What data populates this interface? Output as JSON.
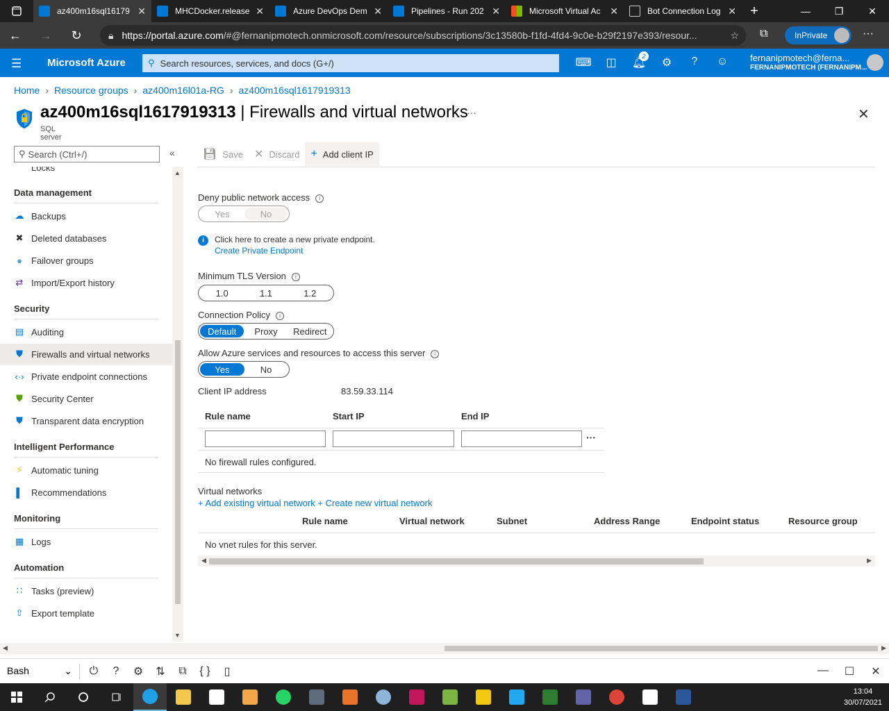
{
  "browser": {
    "tabs": [
      {
        "title": "az400m16sql16179",
        "icon": "azure-icon",
        "active": true
      },
      {
        "title": "MHCDocker.release",
        "icon": "devops-icon",
        "active": false
      },
      {
        "title": "Azure DevOps Dem",
        "icon": "devops-icon",
        "active": false
      },
      {
        "title": "Pipelines - Run 202",
        "icon": "devops-icon",
        "active": false
      },
      {
        "title": "Microsoft Virtual Ac",
        "icon": "microsoft-icon",
        "active": false
      },
      {
        "title": "Bot Connection Log",
        "icon": "document-icon",
        "active": false
      }
    ],
    "url_host": "https://portal.azure.com",
    "url_rest": "/#@fernanipmotech.onmicrosoft.com/resource/subscriptions/3c13580b-f1fd-4fd4-9c0e-b29f2197e393/resour...",
    "inprivate_label": "InPrivate"
  },
  "azure_header": {
    "brand": "Microsoft Azure",
    "search_placeholder": "Search resources, services, and docs (G+/)",
    "notifications_count": "2",
    "account_name": "fernanipmotech@ferna...",
    "account_tenant": "FERNANIPMOTECH (FERNANIPM..."
  },
  "breadcrumb": [
    "Home",
    "Resource groups",
    "az400m16l01a-RG",
    "az400m16sql1617919313"
  ],
  "page": {
    "resource_name": "az400m16sql1617919313",
    "title_sep": " | ",
    "blade_title": "Firewalls and virtual networks",
    "subtitle": "SQL server"
  },
  "sidebar": {
    "search_placeholder": "Search (Ctrl+/)",
    "cut_item": "Locks",
    "sections": [
      {
        "title": "Data management",
        "items": [
          {
            "label": "Backups",
            "icon": "cloud-backup-icon"
          },
          {
            "label": "Deleted databases",
            "icon": "trash-icon"
          },
          {
            "label": "Failover groups",
            "icon": "globe-icon"
          },
          {
            "label": "Import/Export history",
            "icon": "import-export-icon"
          }
        ]
      },
      {
        "title": "Security",
        "items": [
          {
            "label": "Auditing",
            "icon": "auditing-icon"
          },
          {
            "label": "Firewalls and virtual networks",
            "icon": "shield-icon",
            "selected": true
          },
          {
            "label": "Private endpoint connections",
            "icon": "endpoint-icon"
          },
          {
            "label": "Security Center",
            "icon": "security-center-icon"
          },
          {
            "label": "Transparent data encryption",
            "icon": "shield-icon"
          }
        ]
      },
      {
        "title": "Intelligent Performance",
        "items": [
          {
            "label": "Automatic tuning",
            "icon": "lightning-icon"
          },
          {
            "label": "Recommendations",
            "icon": "recommendations-icon"
          }
        ]
      },
      {
        "title": "Monitoring",
        "items": [
          {
            "label": "Logs",
            "icon": "logs-icon"
          }
        ]
      },
      {
        "title": "Automation",
        "items": [
          {
            "label": "Tasks (preview)",
            "icon": "tasks-icon"
          },
          {
            "label": "Export template",
            "icon": "export-template-icon"
          }
        ]
      }
    ]
  },
  "toolbar": {
    "save": "Save",
    "discard": "Discard",
    "add_client_ip": "Add client IP"
  },
  "settings": {
    "deny_public_label": "Deny public network access",
    "deny_public_options": [
      "Yes",
      "No"
    ],
    "deny_public_selected": "No",
    "private_endpoint_info": "Click here to create a new private endpoint.",
    "private_endpoint_link": "Create Private Endpoint",
    "tls_label": "Minimum TLS Version",
    "tls_options": [
      "1.0",
      "1.1",
      "1.2"
    ],
    "policy_label": "Connection Policy",
    "policy_options": [
      "Default",
      "Proxy",
      "Redirect"
    ],
    "policy_selected": "Default",
    "allow_azure_label": "Allow Azure services and resources to access this server",
    "allow_azure_options": [
      "Yes",
      "No"
    ],
    "allow_azure_selected": "Yes",
    "client_ip_label": "Client IP address",
    "client_ip_value": "83.59.33.114"
  },
  "firewall_table": {
    "columns": [
      "Rule name",
      "Start IP",
      "End IP"
    ],
    "empty_text": "No firewall rules configured."
  },
  "vnet": {
    "title": "Virtual networks",
    "add_existing": "+ Add existing virtual network",
    "create_new": "+ Create new virtual network",
    "columns": [
      "Rule name",
      "Virtual network",
      "Subnet",
      "Address Range",
      "Endpoint status",
      "Resource group"
    ],
    "empty_text": "No vnet rules for this server."
  },
  "shell": {
    "type": "Bash"
  },
  "taskbar": {
    "time": "13:04",
    "date": "30/07/2021"
  },
  "colors": {
    "azure_blue": "#0078d4",
    "browser_dark": "#202020"
  }
}
